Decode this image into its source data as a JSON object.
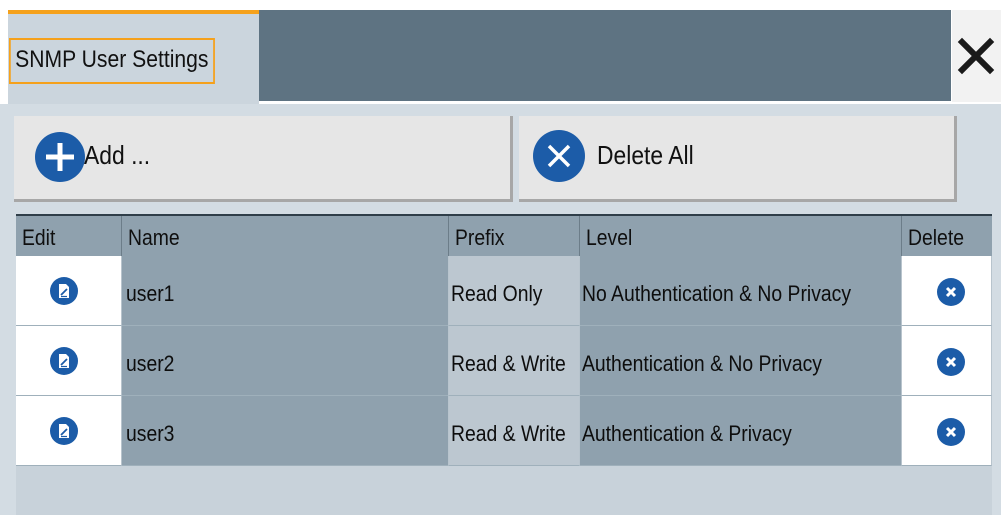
{
  "dialog": {
    "title": "SNMP User Settings"
  },
  "toolbar": {
    "add_label": "Add ...",
    "delete_all_label": "Delete All"
  },
  "table": {
    "headers": {
      "edit": "Edit",
      "name": "Name",
      "prefix": "Prefix",
      "level": "Level",
      "delete": "Delete"
    },
    "rows": [
      {
        "name": "user1",
        "prefix": "Read Only",
        "level": "No Authentication & No Privacy"
      },
      {
        "name": "user2",
        "prefix": "Read & Write",
        "level": "Authentication & No Privacy"
      },
      {
        "name": "user3",
        "prefix": "Read & Write",
        "level": "Authentication & Privacy"
      }
    ]
  },
  "icons": {
    "close": "close-icon",
    "add": "plus-circle-icon",
    "delete_all": "x-circle-icon",
    "edit": "edit-document-icon",
    "delete": "delete-x-icon"
  },
  "colors": {
    "accent": "#f5a11b",
    "button_icon": "#1c5ca8",
    "header_dark": "#5e7382",
    "table_header": "#8fa1ae"
  }
}
